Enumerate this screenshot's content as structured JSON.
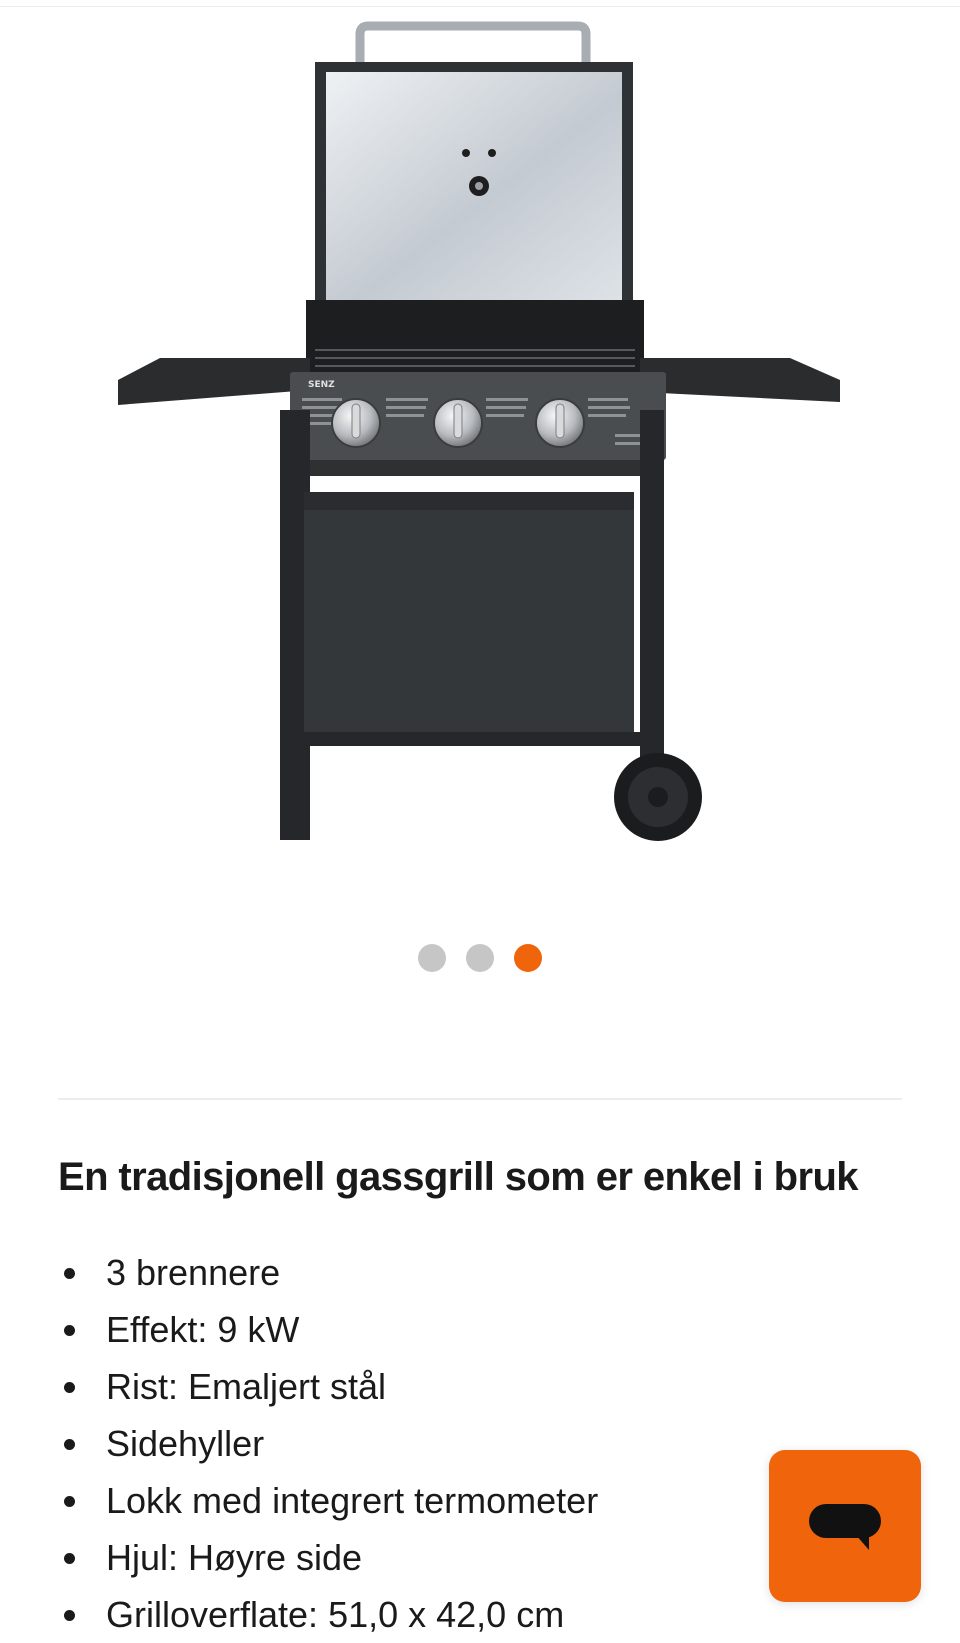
{
  "gallery": {
    "image_name": "gas-grill-product-image",
    "brand_mark": "SENZ",
    "active_slide": 3,
    "slides": [
      {
        "state": "inactive"
      },
      {
        "state": "inactive"
      },
      {
        "state": "active"
      }
    ]
  },
  "product": {
    "heading": "En tradisjonell gassgrill som er enkel i bruk",
    "features": [
      "3 brennere",
      "Effekt: 9 kW",
      "Rist: Emaljert stål",
      "Sidehyller",
      "Lokk med integrert termometer",
      "Hjul: Høyre side",
      "Grilloverflate: 51,0 x 42,0 cm"
    ]
  },
  "chat": {
    "icon": "chat-bubble-icon"
  },
  "colors": {
    "accent": "#f0650c",
    "dot_inactive": "#c6c6c6",
    "text": "#1a1a1a",
    "divider": "#ececec"
  }
}
